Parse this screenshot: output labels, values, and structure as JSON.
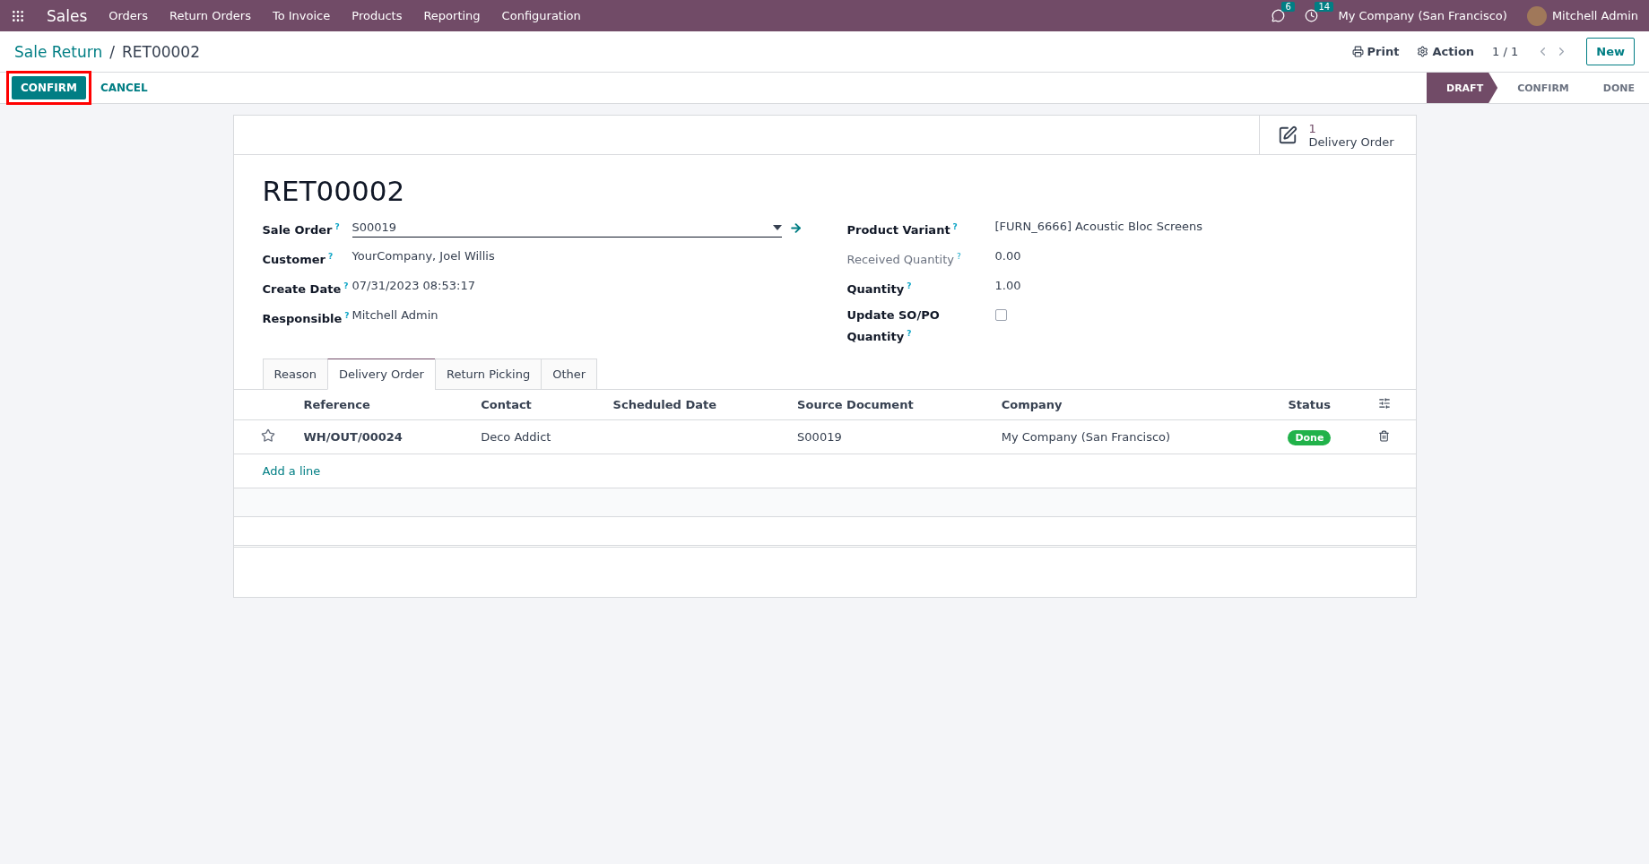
{
  "navbar": {
    "app": "Sales",
    "menu": [
      "Orders",
      "Return Orders",
      "To Invoice",
      "Products",
      "Reporting",
      "Configuration"
    ],
    "messages_count": "6",
    "activities_count": "14",
    "company": "My Company (San Francisco)",
    "user": "Mitchell Admin"
  },
  "breadcrumb": {
    "parent": "Sale Return",
    "separator": "/",
    "current": "RET00002"
  },
  "control": {
    "print": "Print",
    "action": "Action",
    "pager": "1 / 1",
    "new": "New"
  },
  "actions": [
    {
      "label": "CONFIRM",
      "kind": "primary",
      "highlighted": true
    },
    {
      "label": "CANCEL",
      "kind": "link",
      "highlighted": false
    }
  ],
  "stages": [
    {
      "label": "DRAFT",
      "selected": true
    },
    {
      "label": "CONFIRM",
      "selected": false
    },
    {
      "label": "DONE",
      "selected": false
    }
  ],
  "smart_button": {
    "count": "1",
    "label": "Delivery Order"
  },
  "title": "RET00002",
  "left_fields": [
    {
      "label": "Sale Order",
      "help": "?",
      "value": "S00019",
      "kind": "select"
    },
    {
      "label": "Customer",
      "help": "?",
      "value": "YourCompany, Joel Willis",
      "kind": "text"
    },
    {
      "label": "Create Date",
      "help": "?",
      "value": "07/31/2023 08:53:17",
      "kind": "text"
    },
    {
      "label": "Responsible",
      "help": "?",
      "value": "Mitchell Admin",
      "kind": "text"
    }
  ],
  "right_fields": [
    {
      "label": "Product Variant",
      "help": "?",
      "value": "[FURN_6666] Acoustic Bloc Screens",
      "kind": "text",
      "muted": false
    },
    {
      "label": "Received Quantity",
      "help": "?",
      "value": "0.00",
      "kind": "text",
      "muted": true
    },
    {
      "label": "Quantity",
      "help": "?",
      "value": "1.00",
      "kind": "text",
      "muted": false
    },
    {
      "label": "Update SO/PO Quantity",
      "help": "?",
      "kind": "checkbox",
      "checked": false,
      "muted": false
    }
  ],
  "tabs": [
    {
      "label": "Reason",
      "selected": false
    },
    {
      "label": "Delivery Order",
      "selected": true
    },
    {
      "label": "Return Picking",
      "selected": false
    },
    {
      "label": "Other",
      "selected": false
    }
  ],
  "table": {
    "columns": [
      "Reference",
      "Contact",
      "Scheduled Date",
      "Source Document",
      "Company",
      "Status"
    ],
    "rows": [
      {
        "starred": false,
        "cells": [
          "WH/OUT/00024",
          "Deco Addict",
          "",
          "S00019",
          "My Company (San Francisco)"
        ],
        "status": "Done"
      }
    ],
    "add_line": "Add a line"
  }
}
